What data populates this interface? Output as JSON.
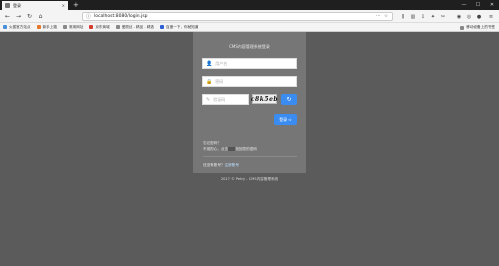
{
  "browser": {
    "tab_title": "登录",
    "tab_close": "×",
    "new_tab": "+",
    "url": "localhost:8080/login.jsp",
    "window_controls": [
      "—",
      "☐",
      "✕"
    ]
  },
  "bookmarks": [
    {
      "label": "火狐官方站点",
      "color": "#4a90d9"
    },
    {
      "label": "新手上路",
      "color": "#e5772d"
    },
    {
      "label": "常用网址",
      "color": "#888888"
    },
    {
      "label": "京东商城",
      "color": "#d63b2f"
    },
    {
      "label": "爱丽丝 - 精品 - 精选",
      "color": "#888888"
    },
    {
      "label": "百度一下，你就知道",
      "color": "#3060d6"
    }
  ],
  "bookmarks_mobile": "移动设备上的书签",
  "login": {
    "title": "CMS内容管理系统登录",
    "username_placeholder": "用户名",
    "password_placeholder": "密码",
    "captcha_placeholder": "验证码",
    "captcha_text": "c8k5eb",
    "login_button": "登录 ➪",
    "forgot_title": "忘记密码？",
    "forgot_desc_prefix": "不用担心，点击",
    "forgot_desc_link": "这里",
    "forgot_desc_suffix": "找回您的密码",
    "register_prefix": "还没有账号？",
    "register_link": "注册账号"
  },
  "footer": "2017 © Petry - CMS内容管理系统",
  "colors": {
    "accent": "#3b8cf0",
    "page_bg": "#5b5b5b",
    "panel_bg": "#767676"
  }
}
